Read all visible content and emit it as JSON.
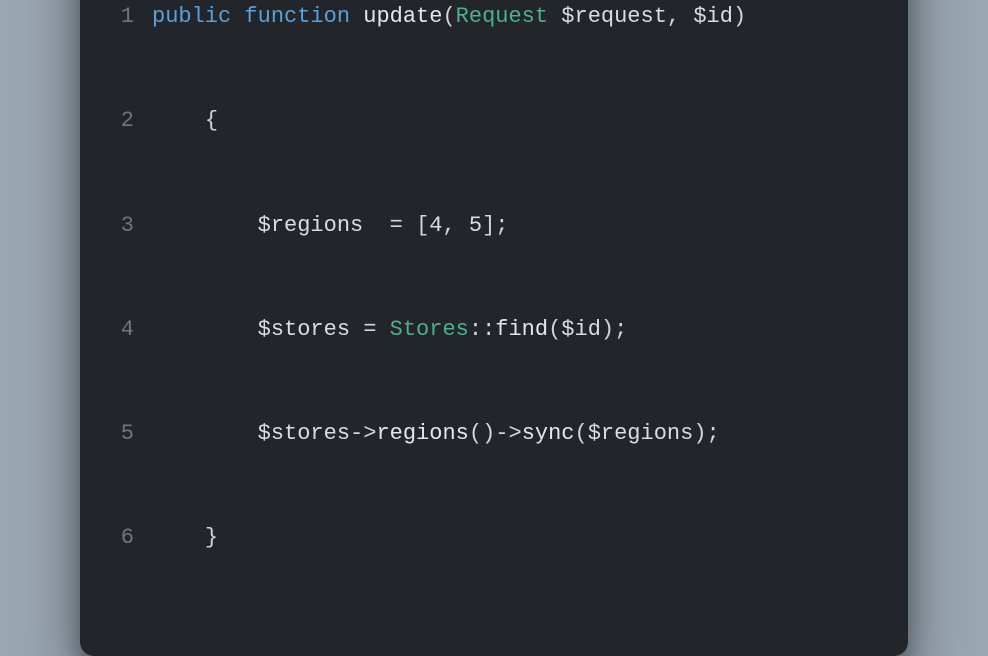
{
  "window": {
    "controls": [
      "close",
      "minimize",
      "zoom"
    ]
  },
  "code": {
    "lines": [
      {
        "n": "1",
        "indent0": "",
        "tokens": {
          "kw_public": "public",
          "sp1": " ",
          "kw_function": "function",
          "sp2": " ",
          "fn_name": "update",
          "paren_open": "(",
          "type_request": "Request",
          "sp3": " ",
          "var_request": "$request",
          "comma": ",",
          "sp4": " ",
          "var_id": "$id",
          "paren_close": ")"
        }
      },
      {
        "n": "2",
        "indent": "    ",
        "brace_open": "{"
      },
      {
        "n": "3",
        "indent": "        ",
        "tokens": {
          "var_regions": "$regions",
          "sp1": "  ",
          "eq": "=",
          "sp2": " ",
          "bracket_open": "[",
          "num1": "4",
          "comma": ",",
          "sp3": " ",
          "num2": "5",
          "bracket_close": "]",
          "semi": ";"
        }
      },
      {
        "n": "4",
        "indent": "        ",
        "tokens": {
          "var_stores": "$stores",
          "sp1": " ",
          "eq": "=",
          "sp2": " ",
          "type_stores": "Stores",
          "dbcolon": "::",
          "fn_find": "find",
          "paren_open": "(",
          "var_id": "$id",
          "paren_close": ")",
          "semi": ";"
        }
      },
      {
        "n": "5",
        "indent": "        ",
        "tokens": {
          "var_stores": "$stores",
          "arrow1": "->",
          "fn_regions": "regions",
          "paren1o": "(",
          "paren1c": ")",
          "arrow2": "->",
          "fn_sync": "sync",
          "paren2o": "(",
          "var_regions": "$regions",
          "paren2c": ")",
          "semi": ";"
        }
      },
      {
        "n": "6",
        "indent": "    ",
        "brace_close": "}"
      }
    ]
  }
}
